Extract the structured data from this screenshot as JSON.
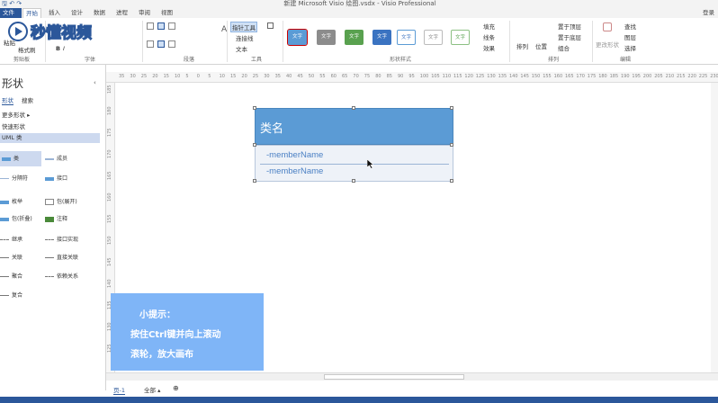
{
  "titlebar": {
    "title": "新建 Microsoft Visio 绘图.vsdx - Visio Professional",
    "quick_access": "🖫 ↶ ↷"
  },
  "tabs": [
    {
      "label": "文件"
    },
    {
      "label": "开始"
    },
    {
      "label": "插入"
    },
    {
      "label": "设计"
    },
    {
      "label": "数据"
    },
    {
      "label": "进程"
    },
    {
      "label": "审阅"
    },
    {
      "label": "视图"
    }
  ],
  "login_label": "登录",
  "ribbon": {
    "clipboard": {
      "label": "剪贴板",
      "format_painter": "格式刷",
      "paste": "粘贴"
    },
    "font": {
      "label": "字体"
    },
    "paragraph": {
      "label": "段落"
    },
    "tools": {
      "label": "工具",
      "pointer": "指针工具",
      "connector": "连接线",
      "text": "文本"
    },
    "shape_styles": {
      "label": "形状样式",
      "style_text": "文字",
      "fill": "填充",
      "line": "线条",
      "effect": "效果"
    },
    "arrange": {
      "label": "排列",
      "align": "排列",
      "position": "位置",
      "bring_front": "置于顶层",
      "send_back": "置于底层",
      "group": "组合"
    },
    "edit": {
      "label": "编辑",
      "change_shape": "更改形状",
      "find": "查找",
      "layers": "图层",
      "select": "选择"
    }
  },
  "logo_text": "秒懂视频",
  "left_panel": {
    "title": "形状",
    "tab_shapes": "形状",
    "tab_search": "搜索",
    "more_shapes": "更多形状",
    "quick_shapes": "快速形状",
    "uml_class": "UML 类",
    "shapes": [
      {
        "label": "类"
      },
      {
        "label": "成员"
      },
      {
        "label": "分隔符"
      },
      {
        "label": "接口"
      },
      {
        "label": "枚举"
      },
      {
        "label": "包(展开)"
      },
      {
        "label": "包(折叠)"
      },
      {
        "label": "注释"
      },
      {
        "label": "继承"
      },
      {
        "label": "接口实现"
      },
      {
        "label": "关联"
      },
      {
        "label": "直接关联"
      },
      {
        "label": "聚合"
      },
      {
        "label": "依赖关系"
      },
      {
        "label": "复合"
      }
    ]
  },
  "ruler": {
    "h_ticks": [
      "35",
      "30",
      "25",
      "20",
      "15",
      "10",
      "5",
      "0",
      "5",
      "10",
      "15",
      "20",
      "25",
      "30",
      "35",
      "40",
      "45",
      "50",
      "55",
      "60",
      "65",
      "70",
      "75",
      "80",
      "85",
      "90",
      "95",
      "100",
      "105",
      "110",
      "115",
      "120",
      "125",
      "130",
      "135",
      "140",
      "145",
      "150",
      "155",
      "160",
      "165",
      "170",
      "175",
      "180",
      "185",
      "190",
      "195",
      "200",
      "205",
      "210",
      "215",
      "220",
      "225",
      "230"
    ],
    "v_ticks": [
      "185",
      "180",
      "175",
      "170",
      "165",
      "160",
      "155",
      "150",
      "145",
      "140",
      "135",
      "130",
      "125"
    ]
  },
  "uml_class": {
    "name": "类名",
    "members": [
      "-memberName",
      "-memberName"
    ]
  },
  "tip": {
    "line1": "小提示：",
    "line2": "按住Ctrl键并向上滚动",
    "line3": "滚轮，放大画布"
  },
  "page_tabs": {
    "page1": "页-1",
    "all": "全部",
    "add": "⊕"
  },
  "colors": {
    "accent": "#2b579a",
    "uml_header": "#5b9bd5",
    "tip_bg": "#7fb5f7"
  }
}
